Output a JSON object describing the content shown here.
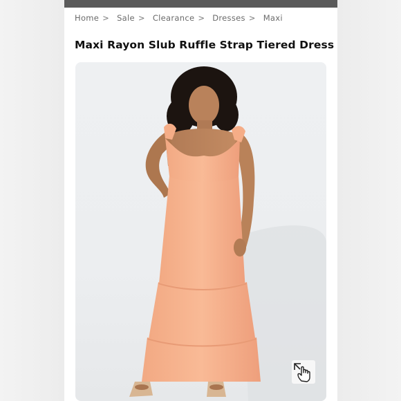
{
  "breadcrumb": {
    "items": [
      "Home",
      "Sale",
      "Clearance",
      "Dresses",
      "Maxi"
    ],
    "separator": ">"
  },
  "product": {
    "title": "Maxi Rayon Slub Ruffle Strap Tiered Dress",
    "image_alt": "Model wearing peach maxi dress",
    "dress_color": "#f7b48f"
  },
  "icons": {
    "zoom": "zoom-hand-icon"
  }
}
